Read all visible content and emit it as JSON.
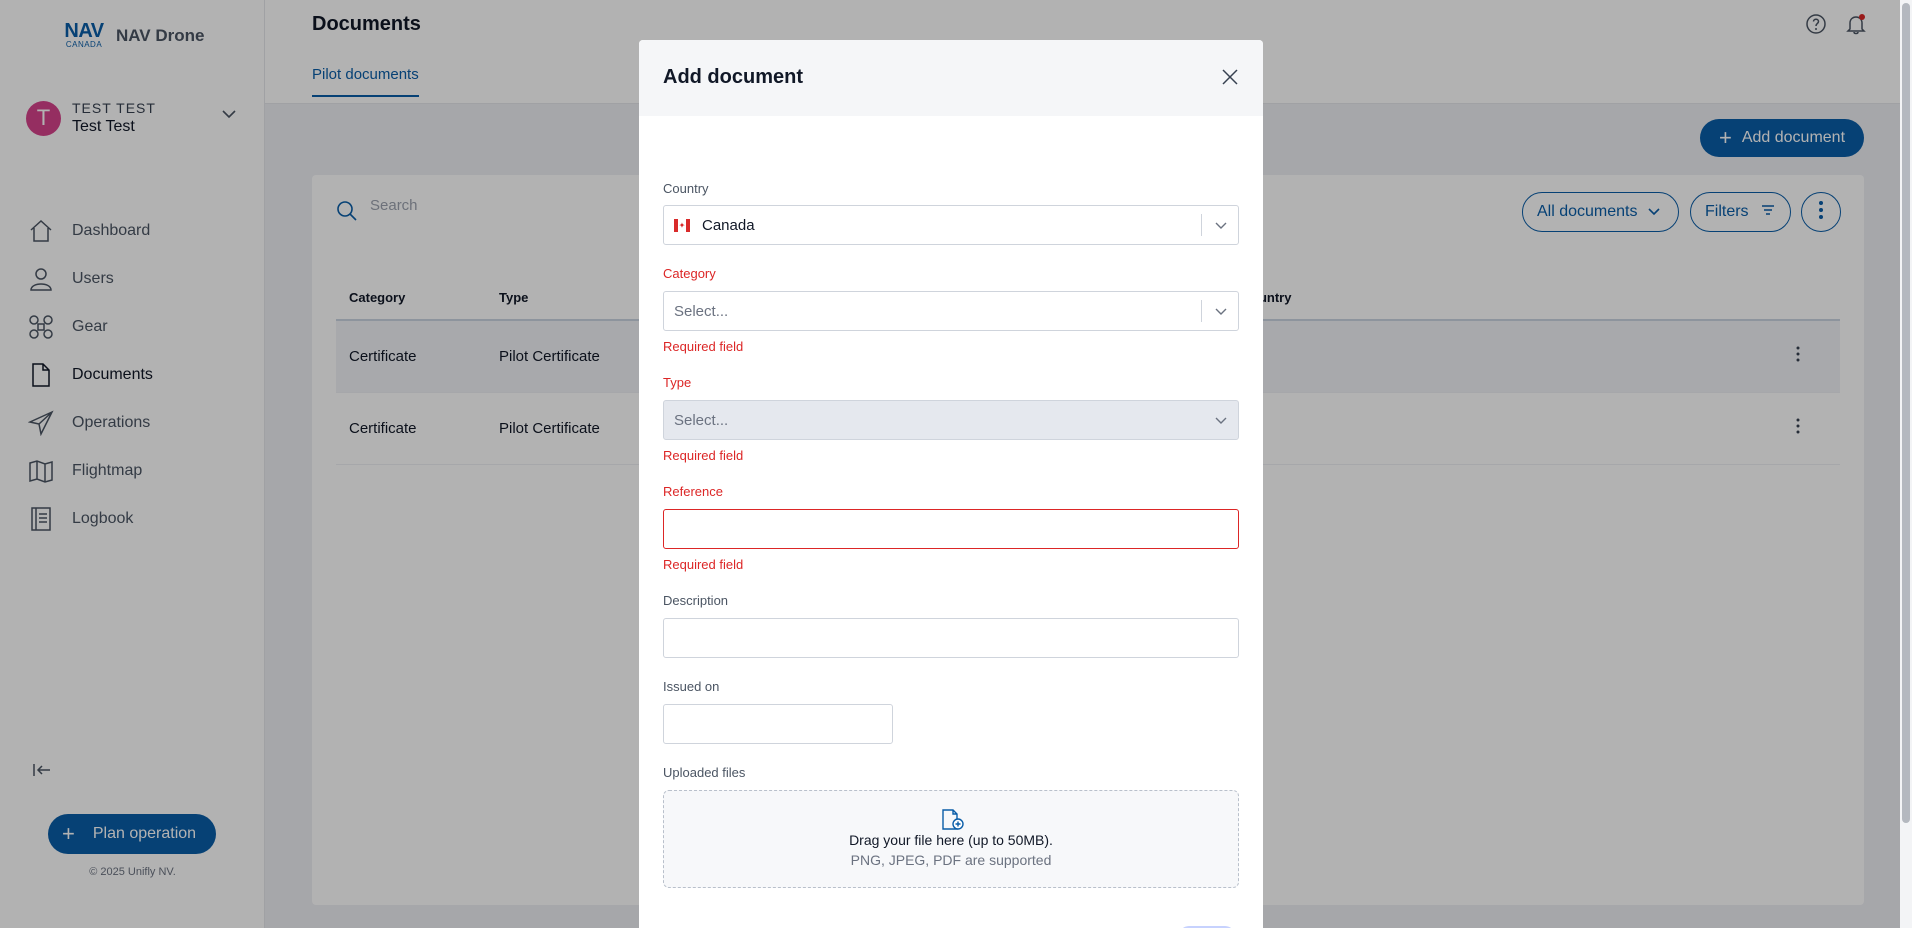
{
  "sidebar": {
    "logo_mark": "NAV",
    "logo_mark_sub": "CANADA",
    "app_name": "NAV Drone",
    "user": {
      "initial": "T",
      "caps_name": "TEST TEST",
      "name": "Test Test"
    },
    "items": [
      {
        "label": "Dashboard",
        "icon": "home-icon"
      },
      {
        "label": "Users",
        "icon": "user-icon"
      },
      {
        "label": "Gear",
        "icon": "drone-icon"
      },
      {
        "label": "Documents",
        "icon": "document-icon",
        "active": true
      },
      {
        "label": "Operations",
        "icon": "paper-plane-icon"
      },
      {
        "label": "Flightmap",
        "icon": "map-icon"
      },
      {
        "label": "Logbook",
        "icon": "logbook-icon"
      }
    ],
    "plan_button": "Plan operation",
    "copyright": "© 2025 Unifly NV."
  },
  "header": {
    "title": "Documents",
    "tab": "Pilot documents"
  },
  "toolbar": {
    "add_document": "Add document",
    "search_placeholder": "Search",
    "all_documents": "All documents",
    "filters": "Filters"
  },
  "table": {
    "headers": {
      "category": "Category",
      "type": "Type",
      "country": "ountry"
    },
    "rows": [
      {
        "category": "Certificate",
        "type": "Pilot Certificate"
      },
      {
        "category": "Certificate",
        "type": "Pilot Certificate"
      }
    ]
  },
  "modal": {
    "title": "Add document",
    "country": {
      "label": "Country",
      "value": "Canada"
    },
    "category": {
      "label": "Category",
      "placeholder": "Select...",
      "error": "Required field"
    },
    "type": {
      "label": "Type",
      "placeholder": "Select...",
      "error": "Required field"
    },
    "reference": {
      "label": "Reference",
      "value": "",
      "error": "Required field"
    },
    "description": {
      "label": "Description",
      "value": ""
    },
    "issued_on": {
      "label": "Issued on",
      "value": ""
    },
    "uploaded_files": {
      "label": "Uploaded files",
      "drop_text": "Drag your file here (up to 50MB).",
      "supported_text": "PNG, JPEG, PDF are supported"
    }
  },
  "colors": {
    "brand": "#0a5da8",
    "error": "#dc2626",
    "avatar": "#d6438b"
  }
}
